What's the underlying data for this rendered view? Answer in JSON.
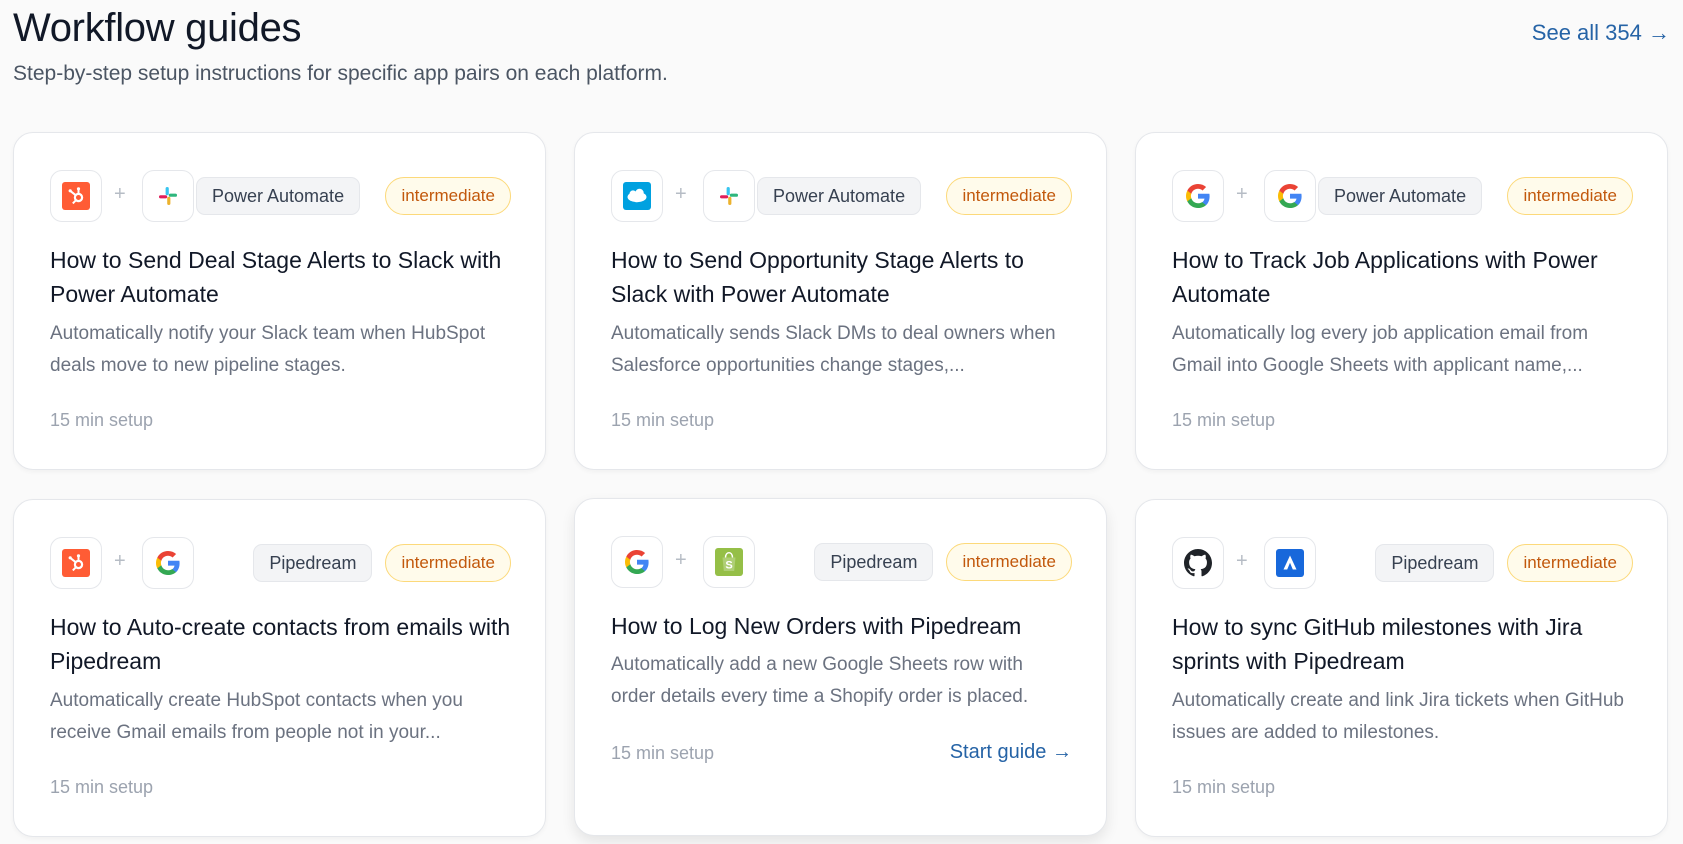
{
  "header": {
    "title": "Workflow guides",
    "subtitle": "Step-by-step setup instructions for specific app pairs on each platform.",
    "see_all": "See all 354 →"
  },
  "icons": {
    "hubspot": "hubspot-icon",
    "slack": "slack-icon",
    "salesforce": "salesforce-icon",
    "google": "google-icon",
    "shopify": "shopify-icon",
    "github": "github-icon",
    "jira": "jira-icon"
  },
  "colors": {
    "accent_link": "#2563a6",
    "badge_level_text": "#c2580c",
    "badge_level_border": "#fcd97a",
    "hubspot": "#ff5c35",
    "salesforce": "#00a1e0",
    "shopify": "#95bf47",
    "jira": "#1868db"
  },
  "cards": [
    {
      "title": "How to Send Deal Stage Alerts to Slack with Power Automate",
      "description": "Automatically notify your Slack team when HubSpot deals move to new pipeline stages.",
      "platform": "Power Automate",
      "level": "intermediate",
      "setup": "15 min setup",
      "app_a": "hubspot",
      "app_b": "slack"
    },
    {
      "title": "How to Send Opportunity Stage Alerts to Slack with Power Automate",
      "description": "Automatically sends Slack DMs to deal owners when Salesforce opportunities change stages,...",
      "platform": "Power Automate",
      "level": "intermediate",
      "setup": "15 min setup",
      "app_a": "salesforce",
      "app_b": "slack"
    },
    {
      "title": "How to Track Job Applications with Power Automate",
      "description": "Automatically log every job application email from Gmail into Google Sheets with applicant name,...",
      "platform": "Power Automate",
      "level": "intermediate",
      "setup": "15 min setup",
      "app_a": "google",
      "app_b": "google"
    },
    {
      "title": "How to Auto-create contacts from emails with Pipedream",
      "description": "Automatically create HubSpot contacts when you receive Gmail emails from people not in your...",
      "platform": "Pipedream",
      "level": "intermediate",
      "setup": "15 min setup",
      "app_a": "hubspot",
      "app_b": "google"
    },
    {
      "title": "How to Log New Orders with Pipedream",
      "description": "Automatically add a new Google Sheets row with order details every time a Shopify order is placed.",
      "platform": "Pipedream",
      "level": "intermediate",
      "setup": "15 min setup",
      "start_guide": "Start guide →",
      "app_a": "google",
      "app_b": "shopify"
    },
    {
      "title": "How to sync GitHub milestones with Jira sprints with Pipedream",
      "description": "Automatically create and link Jira tickets when GitHub issues are added to milestones.",
      "platform": "Pipedream",
      "level": "intermediate",
      "setup": "15 min setup",
      "app_a": "github",
      "app_b": "jira"
    }
  ]
}
